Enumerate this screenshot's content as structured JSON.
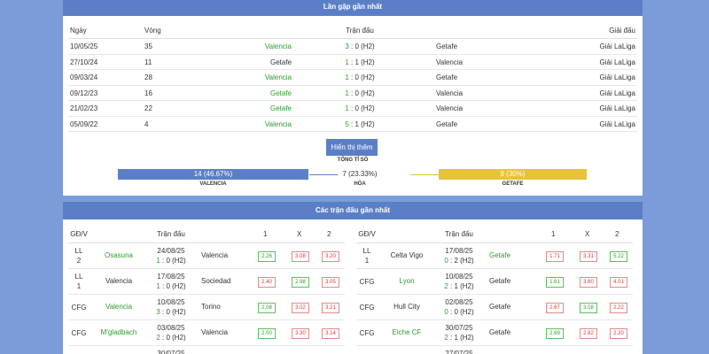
{
  "h2h": {
    "title": "Lần gặp gần nhất",
    "headers": {
      "date": "Ngày",
      "round": "Vòng",
      "match": "Trận đấu",
      "league": "Giải đấu"
    },
    "rows": [
      {
        "date": "10/05/25",
        "round": "35",
        "home": "Valencia",
        "home_win": true,
        "score_home": "3",
        "score_rest": ": 0 (H2)",
        "away": "Getafe",
        "away_win": false,
        "league": "Giải LaLiga"
      },
      {
        "date": "27/10/24",
        "round": "11",
        "home": "Getafe",
        "home_win": false,
        "score_home": "1",
        "score_rest": ": 1 (H2)",
        "away": "Valencia",
        "away_win": false,
        "league": "Giải LaLiga"
      },
      {
        "date": "09/03/24",
        "round": "28",
        "home": "Valencia",
        "home_win": true,
        "score_home": "1",
        "score_rest": ": 0 (H2)",
        "away": "Getafe",
        "away_win": false,
        "league": "Giải LaLiga"
      },
      {
        "date": "09/12/23",
        "round": "16",
        "home": "Getafe",
        "home_win": true,
        "score_home": "1",
        "score_rest": ": 0 (H2)",
        "away": "Valencia",
        "away_win": false,
        "league": "Giải LaLiga"
      },
      {
        "date": "21/02/23",
        "round": "22",
        "home": "Getafe",
        "home_win": true,
        "score_home": "1",
        "score_rest": ": 0 (H2)",
        "away": "Valencia",
        "away_win": false,
        "league": "Giải LaLiga"
      },
      {
        "date": "05/09/22",
        "round": "4",
        "home": "Valencia",
        "home_win": true,
        "score_home": "5",
        "score_rest": ": 1 (H2)",
        "away": "Getafe",
        "away_win": false,
        "league": "Giải LaLiga"
      }
    ],
    "show_more": "Hiển thị thêm",
    "ratio_title": "TỔNG TỈ SỐ",
    "valencia_wins": "14 (46.67%)",
    "draws": "7 (23.33%)",
    "getafe_wins": "9 (30%)",
    "valencia_label": "VALENCIA",
    "draw_label": "HÒA",
    "getafe_label": "GETAFE"
  },
  "recent": {
    "title": "Các trận đấu gần nhất",
    "headers": {
      "type": "GĐ/V",
      "match": "Trận đấu",
      "o1": "1",
      "ox": "X",
      "o2": "2"
    },
    "left_rows": [
      {
        "type1": "LL",
        "type2": "2",
        "home": "Osasuna",
        "home_green": true,
        "date": "24/08/25",
        "score_home": "1",
        "score_rest": ": 0 (H2)",
        "away": "Valencia",
        "away_green": false,
        "o1": "2.26",
        "o1c": "g",
        "ox": "3.08",
        "oxc": "r",
        "o2": "3.20",
        "o2c": "r"
      },
      {
        "type1": "LL",
        "type2": "1",
        "home": "Valencia",
        "home_green": false,
        "date": "17/08/25",
        "score_home": "1",
        "score_rest": ": 0 (H2)",
        "away": "Sociedad",
        "away_green": false,
        "o1": "2.40",
        "o1c": "r",
        "ox": "2.98",
        "oxc": "g",
        "o2": "3.05",
        "o2c": "r"
      },
      {
        "type1": "CFG",
        "type2": "",
        "home": "Valencia",
        "home_green": true,
        "date": "10/08/25",
        "score_home": "3",
        "score_rest": ": 0 (H2)",
        "away": "Torino",
        "away_green": false,
        "o1": "2.08",
        "o1c": "g",
        "ox": "3.02",
        "oxc": "r",
        "o2": "3.21",
        "o2c": "r"
      },
      {
        "type1": "CFG",
        "type2": "",
        "home": "M'gladbach",
        "home_green": true,
        "date": "03/08/25",
        "score_home": "2",
        "score_rest": ": 0 (H2)",
        "away": "Valencia",
        "away_green": false,
        "o1": "2.00",
        "o1c": "g",
        "ox": "3.30",
        "oxc": "r",
        "o2": "3.14",
        "o2c": "r"
      },
      {
        "type1": "",
        "type2": "",
        "home": "",
        "home_green": false,
        "date": "30/07/25",
        "score_home": "",
        "score_rest": "",
        "away": "",
        "away_green": false,
        "o1": "",
        "o1c": "",
        "ox": "",
        "oxc": "",
        "o2": "",
        "o2c": ""
      }
    ],
    "right_rows": [
      {
        "type1": "LL",
        "type2": "1",
        "home": "Celta Vigo",
        "home_green": false,
        "date": "17/08/25",
        "score_home": "0",
        "score_rest": ": 2 (H2)",
        "away": "Getafe",
        "away_green": true,
        "o1": "1.71",
        "o1c": "r",
        "ox": "3.31",
        "oxc": "r",
        "o2": "5.22",
        "o2c": "g"
      },
      {
        "type1": "CFG",
        "type2": "",
        "home": "Lyon",
        "home_green": true,
        "date": "10/08/25",
        "score_home": "2",
        "score_rest": ": 1 (H2)",
        "away": "Getafe",
        "away_green": false,
        "o1": "1.61",
        "o1c": "g",
        "ox": "3.60",
        "oxc": "r",
        "o2": "4.01",
        "o2c": "r"
      },
      {
        "type1": "CFG",
        "type2": "",
        "home": "Hull City",
        "home_green": false,
        "date": "02/08/25",
        "score_home": "0",
        "score_rest": ": 0 (H2)",
        "away": "Getafe",
        "away_green": false,
        "o1": "2.67",
        "o1c": "r",
        "ox": "3.08",
        "oxc": "g",
        "o2": "2.22",
        "o2c": "r"
      },
      {
        "type1": "CFG",
        "type2": "",
        "home": "Elche CF",
        "home_green": true,
        "date": "30/07/25",
        "score_home": "2",
        "score_rest": ": 1 (H2)",
        "away": "Getafe",
        "away_green": false,
        "o1": "2.69",
        "o1c": "g",
        "ox": "2.82",
        "oxc": "r",
        "o2": "2.20",
        "o2c": "r"
      },
      {
        "type1": "",
        "type2": "",
        "home": "",
        "home_green": false,
        "date": "27/07/25",
        "score_home": "",
        "score_rest": "",
        "away": "",
        "away_green": false,
        "o1": "",
        "o1c": "",
        "ox": "",
        "oxc": "",
        "o2": "",
        "o2c": ""
      }
    ]
  },
  "colors": {
    "header_blue": "#5b7fc7",
    "background": "#7b9cd8",
    "win_green": "#2a9d2a",
    "loss_red": "#d33",
    "draw_yellow": "#e8c33a"
  }
}
